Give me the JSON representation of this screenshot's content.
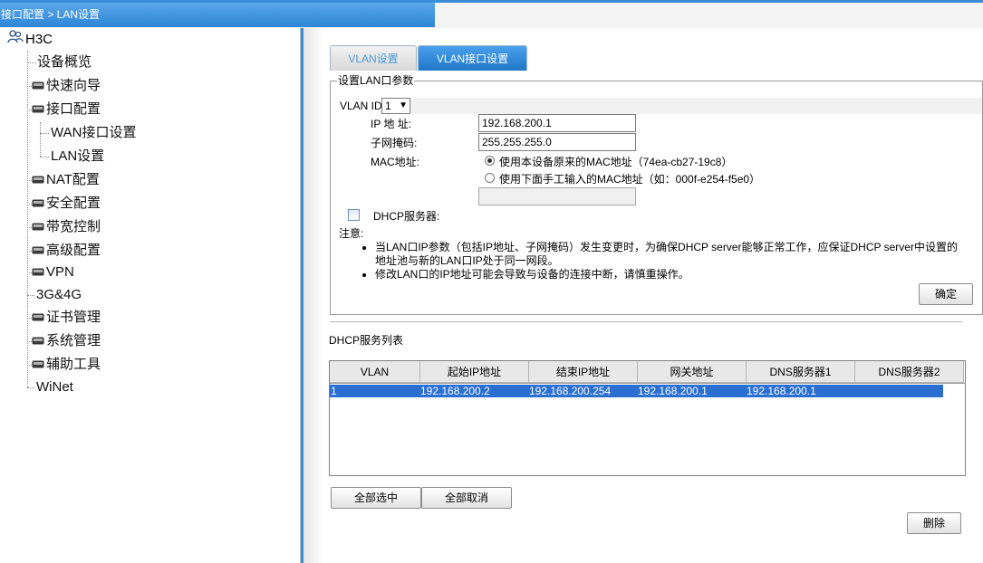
{
  "breadcrumb": "接口配置 > LAN设置",
  "sidebar": {
    "root": "H3C",
    "items": [
      {
        "label": "设备概览"
      },
      {
        "label": "快速向导"
      },
      {
        "label": "接口配置"
      },
      {
        "label": "WAN接口设置"
      },
      {
        "label": "LAN设置"
      },
      {
        "label": "NAT配置"
      },
      {
        "label": "安全配置"
      },
      {
        "label": "带宽控制"
      },
      {
        "label": "高级配置"
      },
      {
        "label": "VPN"
      },
      {
        "label": "3G&4G"
      },
      {
        "label": "证书管理"
      },
      {
        "label": "系统管理"
      },
      {
        "label": "辅助工具"
      },
      {
        "label": "WiNet"
      }
    ]
  },
  "tabs": [
    {
      "label": "VLAN设置"
    },
    {
      "label": "VLAN接口设置"
    }
  ],
  "form": {
    "legend": "设置LAN口参数",
    "vlan_id_label": "VLAN ID",
    "vlan_id_value": "1",
    "ip_label": "IP 地 址:",
    "ip_value": "192.168.200.1",
    "mask_label": "子网掩码:",
    "mask_value": "255.255.255.0",
    "mac_label": "MAC地址:",
    "mac_option1": "使用本设备原来的MAC地址（74ea-cb27-19c8）",
    "mac_option2": "使用下面手工输入的MAC地址（如：000f-e254-f5e0）",
    "mac_manual_value": "",
    "dhcp_label": "DHCP服务器:",
    "note_title": "注意:",
    "notes": [
      "当LAN口IP参数（包括IP地址、子网掩码）发生变更时，为确保DHCP server能够正常工作，应保证DHCP server中设置的地址池与新的LAN口IP处于同一网段。",
      "修改LAN口的IP地址可能会导致与设备的连接中断，请慎重操作。"
    ],
    "confirm_label": "确定"
  },
  "dhcp_list": {
    "title": "DHCP服务列表",
    "columns": [
      "VLAN",
      "起始IP地址",
      "结束IP地址",
      "网关地址",
      "DNS服务器1",
      "DNS服务器2"
    ],
    "rows": [
      [
        "1",
        "192.168.200.2",
        "192.168.200.254",
        "192.168.200.1",
        "192.168.200.1",
        ""
      ]
    ],
    "select_all_label": "全部选中",
    "deselect_all_label": "全部取消",
    "delete_label": "删除"
  },
  "colors": {
    "accent": "#2d86d6",
    "selection": "#2a6fd1"
  }
}
